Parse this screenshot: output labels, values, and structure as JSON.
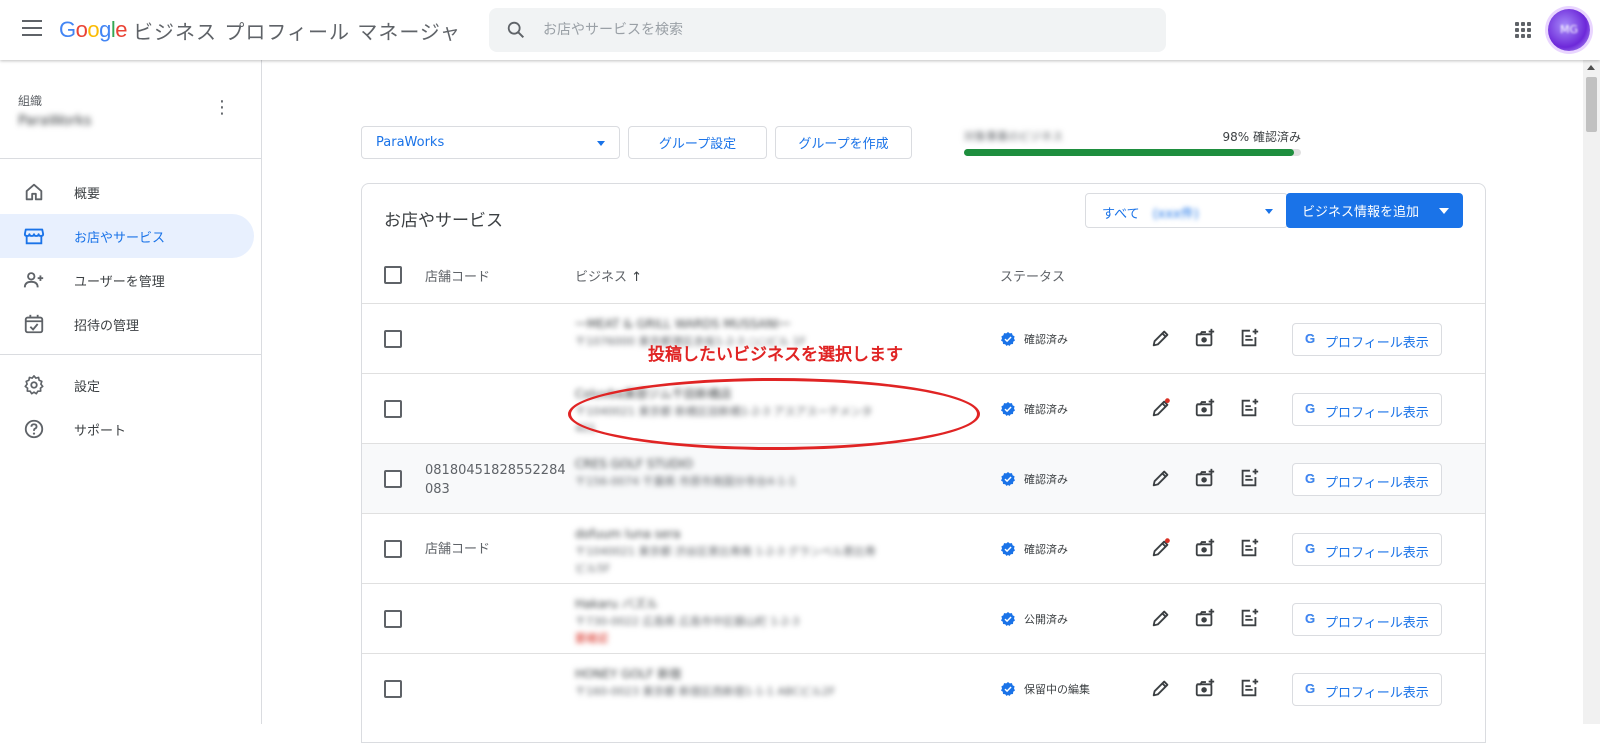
{
  "header": {
    "logo_google": [
      "G",
      "o",
      "o",
      "g",
      "l",
      "e"
    ],
    "product_name": "ビジネス プロフィール マネージャ",
    "search_placeholder": "お店やサービスを検索",
    "avatar_initials": "MG"
  },
  "sidebar": {
    "org_label": "組織",
    "org_name": "ParaWorks",
    "items": [
      {
        "label": "概要",
        "icon": "home-icon"
      },
      {
        "label": "お店やサービス",
        "icon": "storefront-icon",
        "active": true
      },
      {
        "label": "ユーザーを管理",
        "icon": "person-add-icon"
      },
      {
        "label": "招待の管理",
        "icon": "event-available-icon"
      }
    ],
    "items2": [
      {
        "label": "設定",
        "icon": "gear-icon"
      },
      {
        "label": "サポート",
        "icon": "help-icon"
      }
    ]
  },
  "toolbar": {
    "group_value": "ParaWorks",
    "group_settings": "グループ設定",
    "create_group": "グループを作成",
    "progress_label": "対象事業のビジネス",
    "progress_pct": "98% 確認済み",
    "progress_value": 0.98
  },
  "card": {
    "title": "お店やサービス",
    "filter_prefix": "すべて",
    "filter_count": "(xxx件)",
    "add_button": "ビジネス情報を追加",
    "columns": {
      "store_code": "店舗コード",
      "business": "ビジネス",
      "status": "ステータス"
    },
    "rows": [
      {
        "store_code": "",
        "name": "一MEAT & GRILL WARDS MUSSANI一",
        "address": "〒1076000 東京都港区赤坂1-2-3 ○○ビル 1F",
        "warning": "",
        "status": "確認済み",
        "edit_dot": false
      },
      {
        "store_code": "",
        "name": "Coluvba美容ジム千田新橋店",
        "address": "〒1040021 東京都 新橋区田新橋1-2-3 アスアスーテメンタ",
        "warning": "",
        "address2": "401",
        "status": "確認済み",
        "edit_dot": true
      },
      {
        "store_code": "08180451828552284083",
        "store_code_l1": "08180451828552284",
        "store_code_l2": "083",
        "name": "CRES GOLF STUDIO",
        "address": "〒156-0074 千葉県 市原市南国分寺台4-1-1",
        "warning": "",
        "status": "確認済み",
        "edit_dot": false
      },
      {
        "store_code": "店舗コード",
        "name": "dofuum luna sera",
        "address": "〒1040021 東京都 渋谷区恵比寿南 1-2-3 グランベル恵比寿",
        "warning": "",
        "address2": "ビル5F",
        "status": "確認済み",
        "edit_dot": true
      },
      {
        "store_code": "",
        "name": "Hakaru バズル",
        "address": "〒730-0022 広島県 広島市中区銀山町 1-2-3",
        "warning": "要確認",
        "status": "公開済み",
        "edit_dot": false
      },
      {
        "store_code": "",
        "name": "HONEY GOLF 新宿",
        "address": "〒160-0023 東京都 新宿区西新宿1-1-1 ABCビル2F",
        "warning": "",
        "status": "保留中の編集",
        "edit_dot": false
      }
    ],
    "profile_button": "プロフィール表示"
  },
  "annotation": {
    "callout": "投稿したいビジネスを選択します",
    "color": "#e02424"
  },
  "colors": {
    "accent": "#1a73e8",
    "verified": "#1a73e8",
    "progress": "#1e8e3e"
  }
}
